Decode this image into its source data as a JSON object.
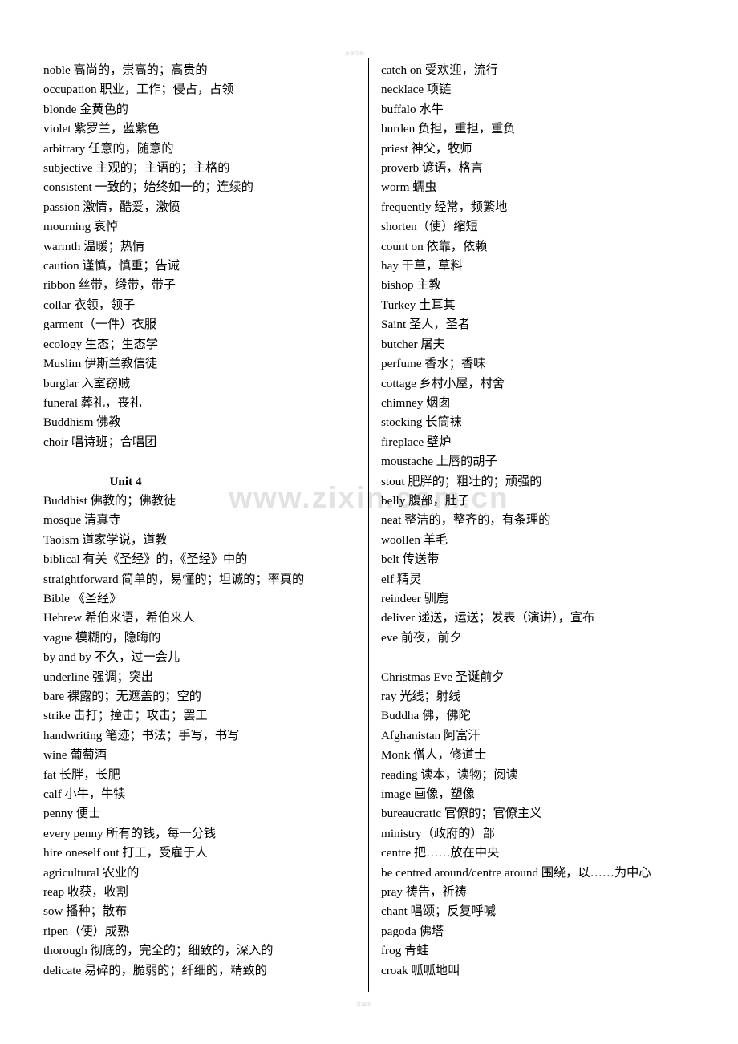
{
  "document": {
    "watermark_center": "www.zixin.com.cn",
    "watermark_top": "共享文档",
    "watermark_bottom": "可编辑"
  },
  "left_column": {
    "entries": [
      "noble 高尚的，崇高的；高贵的",
      "occupation 职业，工作；侵占，占领",
      "blonde     金黄色的",
      "violet    紫罗兰，蓝紫色",
      "arbitrary 任意的，随意的",
      "subjective 主观的；主语的；主格的",
      "consistent 一致的；始终如一的；连续的",
      "passion    激情，酷爱，激愤",
      "mourning 哀悼",
      "warmth 温暖；热情",
      "caution 谨慎，慎重；告诫",
      "ribbon     丝带，缎带，带子",
      "collar 衣领，领子",
      "garment（一件）衣服",
      "ecology 生态；生态学",
      "Muslim 伊斯兰教信徒",
      "burglar 入室窃贼",
      "funeral 葬礼，丧礼",
      "Buddhism 佛教",
      "choir 唱诗班；合唱团"
    ],
    "unit_heading": "Unit 4",
    "entries2": [
      "Buddhist 佛教的；佛教徒",
      "mosque     清真寺",
      "Taoism     道家学说，道教",
      "biblical   有关《圣经》的，《圣经》中的",
      "straightforward 简单的，易懂的；坦诚的；率真的",
      "Bible    《圣经》",
      "Hebrew   希伯来语，希伯来人",
      "vague 模糊的，隐晦的",
      "by and by 不久，过一会儿",
      "underline 强调；突出",
      "bare 裸露的；无遮盖的；空的",
      "strike 击打；撞击；攻击；罢工",
      "handwriting 笔迹；书法；手写，书写",
      "wine 葡萄酒",
      "fat    长胖，长肥",
      "calf    小牛，牛犊",
      "penny 便士",
      "every penny 所有的钱，每一分钱",
      "hire oneself out 打工，受雇于人",
      "agricultural 农业的",
      "reap     收获，收割",
      "sow 播种；散布",
      "ripen（使）成熟",
      "thorough 彻底的，完全的；细致的，深入的",
      "delicate 易碎的，脆弱的；纤细的，精致的"
    ]
  },
  "right_column": {
    "entries": [
      "catch on 受欢迎，流行",
      "necklace 项链",
      "buffalo    水牛",
      "burden 负担，重担，重负",
      "priest     神父，牧师",
      "proverb    谚语，格言",
      "worm 蠕虫",
      "frequently 经常，频繁地",
      "shorten（使）缩短",
      "count on 依靠，依赖",
      "hay    干草，草料",
      "bishop 主教",
      "Turkey 土耳其",
      "Saint    圣人，圣者",
      "butcher 屠夫",
      "perfume 香水；香味",
      "cottage 乡村小屋，村舍",
      "chimney    烟囱",
      "stocking 长筒袜",
      "fireplace   壁炉",
      "moustache 上唇的胡子",
      "stout 肥胖的；粗壮的；顽强的",
      "belly 腹部，肚子",
      "neat 整洁的，整齐的，有条理的",
      "woollen 羊毛",
      "belt 传送带",
      "elf    精灵",
      "reindeer     驯鹿",
      "deliver 递送，运送；发表（演讲），宣布",
      "eve      前夜，前夕"
    ],
    "entries2": [
      "Christmas Eve 圣诞前夕",
      "ray 光线；射线",
      "Buddha 佛，佛陀",
      "Afghanistan 阿富汗",
      "Monk     僧人，修道士",
      "reading 读本，读物；阅读",
      "image    画像，塑像",
      "bureaucratic 官僚的；官僚主义",
      "ministry（政府的）部",
      "centre 把……放在中央",
      "be centred    around/centre around 围绕，以……为中心",
      "pray 祷告，祈祷",
      "chant 唱颂；反复呼喊",
      "pagoda    佛塔",
      "frog 青蛙",
      "croak    呱呱地叫"
    ]
  }
}
